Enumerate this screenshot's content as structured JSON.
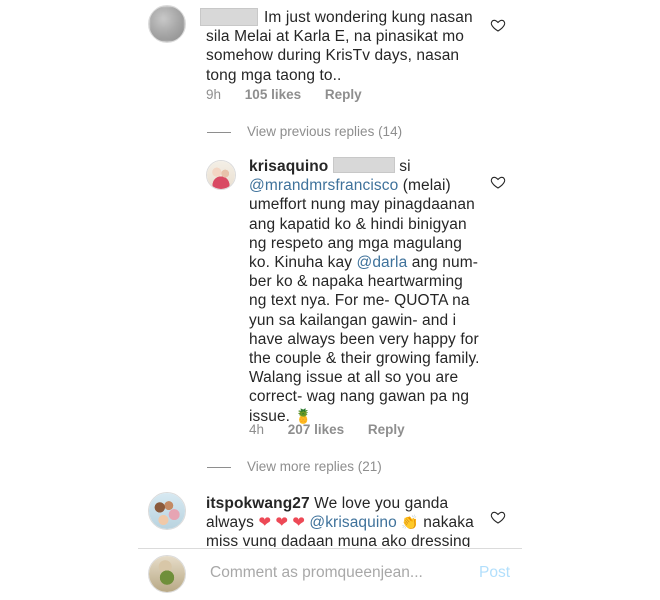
{
  "comments": [
    {
      "text": "Im just wondering kung nasan sila Melai at Karla E, na pinasikat mo somehow during KrisTv days, nasan tong mga taong to..",
      "lines": [
        "Im just wondering kung nasan",
        "sila Melai at Karla E, na pinasikat mo",
        "somehow during KrisTv days, nasan",
        "tong mga taong to.."
      ],
      "time": "9h",
      "likes": "105 likes",
      "reply": "Reply"
    }
  ],
  "view_previous": "View previous replies (14)",
  "reply": {
    "username": "krisaquino",
    "mention_after_user": "si",
    "mention": "@mrandmrsfrancisco",
    "line1_rest": "(melai)",
    "lines": [
      "umeffort nung may pinagdaanan",
      "ang kapatid ko & hindi binigyan",
      "ng respeto ang mga magulang"
    ],
    "line5_a": "ko. Kinuha kay",
    "line5_mention": "@darla",
    "line5_b": "ang num-",
    "lines2": [
      "ber ko & napaka heartwarming",
      "ng text nya. For me- QUOTA na",
      "yun sa kailangan gawin- and i",
      "have always been very happy for",
      "the couple & their growing family.",
      "Walang issue at all so you are",
      "correct- wag nang gawan pa ng"
    ],
    "last_line": "issue.",
    "emoji": "🍍",
    "time": "4h",
    "likes": "207 likes",
    "reply": "Reply"
  },
  "view_more": "View more replies (21)",
  "comment3": {
    "username": "itspokwang27",
    "line1": "We love you ganda",
    "line2_a": "always",
    "hearts": "❤ ❤ ❤",
    "mention": "@krisaquino",
    "emoji": "👏",
    "line2_b": "nakaka",
    "line3": "miss vung dadaan muna ako dressing"
  },
  "composer": {
    "placeholder": "Comment as promqueenjean...",
    "post": "Post"
  },
  "colors": {
    "mention": "#3f729b",
    "muted": "#8e8e8e",
    "heart": "#ed4956",
    "post_disabled": "#b2dffc"
  }
}
